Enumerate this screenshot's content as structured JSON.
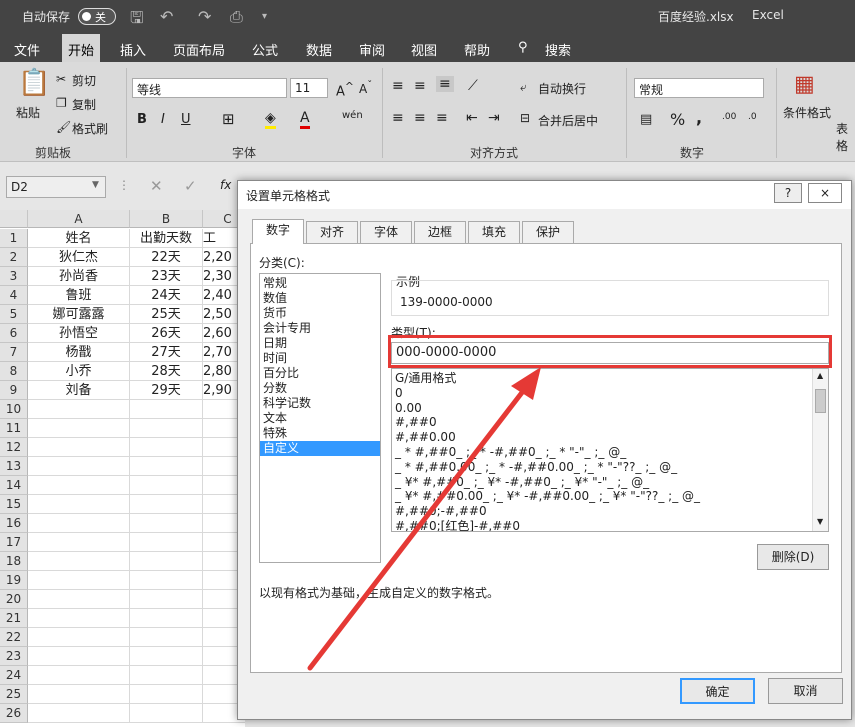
{
  "titlebar": {
    "autosave_label": "自动保存",
    "autosave_state": "关",
    "file_title": "百度经验.xlsx",
    "app_name": "Excel"
  },
  "menus": [
    "文件",
    "开始",
    "插入",
    "页面布局",
    "公式",
    "数据",
    "审阅",
    "视图",
    "帮助",
    "搜索"
  ],
  "ribbon": {
    "paste": "粘贴",
    "cut": "剪切",
    "copy": "复制",
    "format_painter": "格式刷",
    "font_name": "等线",
    "font_size": "11",
    "wrap_text": "自动换行",
    "merge_center": "合并后居中",
    "number_format": "常规",
    "conditional_format": "条件格式",
    "table_format": "表格",
    "groups": {
      "clipboard": "剪贴板",
      "font": "字体",
      "alignment": "对齐方式",
      "number": "数字"
    }
  },
  "namebox": "D2",
  "sheet": {
    "columns": [
      "A",
      "B",
      "C"
    ],
    "headers": [
      "姓名",
      "出勤天数",
      "工"
    ],
    "rows": [
      [
        "狄仁杰",
        "22天",
        "2,20"
      ],
      [
        "孙尚香",
        "23天",
        "2,30"
      ],
      [
        "鲁班",
        "24天",
        "2,40"
      ],
      [
        "娜可露露",
        "25天",
        "2,50"
      ],
      [
        "孙悟空",
        "26天",
        "2,60"
      ],
      [
        "杨戬",
        "27天",
        "2,70"
      ],
      [
        "小乔",
        "28天",
        "2,80"
      ],
      [
        "刘备",
        "29天",
        "2,90"
      ]
    ],
    "row_numbers": [
      "1",
      "2",
      "3",
      "4",
      "5",
      "6",
      "7",
      "8",
      "9",
      "10",
      "11",
      "12",
      "13",
      "14",
      "15",
      "16",
      "17",
      "18",
      "19",
      "20",
      "21",
      "22",
      "23",
      "24",
      "25",
      "26"
    ]
  },
  "dialog": {
    "title": "设置单元格格式",
    "help": "?",
    "close": "×",
    "tabs": [
      "数字",
      "对齐",
      "字体",
      "边框",
      "填充",
      "保护"
    ],
    "category_label": "分类(C):",
    "categories": [
      "常规",
      "数值",
      "货币",
      "会计专用",
      "日期",
      "时间",
      "百分比",
      "分数",
      "科学记数",
      "文本",
      "特殊",
      "自定义"
    ],
    "selected_category": "自定义",
    "sample_label": "示例",
    "sample_value": "139-0000-0000",
    "type_label": "类型(T):",
    "type_value": "000-0000-0000",
    "formats": [
      "G/通用格式",
      "0",
      "0.00",
      "#,##0",
      "#,##0.00",
      "_ * #,##0_ ;_ * -#,##0_ ;_ * \"-\"_ ;_ @_",
      "_ * #,##0.00_ ;_ * -#,##0.00_ ;_ * \"-\"??_ ;_ @_",
      "_ ¥* #,##0_ ;_ ¥* -#,##0_ ;_ ¥* \"-\"_ ;_ @_",
      "_ ¥* #,##0.00_ ;_ ¥* -#,##0.00_ ;_ ¥* \"-\"??_ ;_ @_",
      "#,##0;-#,##0",
      "#,##0;[红色]-#,##0"
    ],
    "delete_button": "删除(D)",
    "description": "以现有格式为基础，生成自定义的数字格式。",
    "ok": "确定",
    "cancel": "取消"
  },
  "accent": "#e53935"
}
